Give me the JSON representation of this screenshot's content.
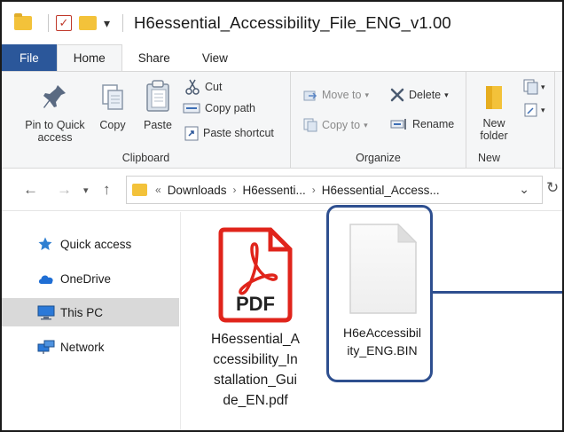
{
  "window": {
    "title": "H6essential_Accessibility_File_ENG_v1.00"
  },
  "tabs": [
    {
      "label": "File"
    },
    {
      "label": "Home"
    },
    {
      "label": "Share"
    },
    {
      "label": "View"
    }
  ],
  "ribbon": {
    "clipboard": {
      "label": "Clipboard",
      "pin": "Pin to Quick access",
      "pin_line1": "Pin to Quick",
      "pin_line2": "access",
      "copy": "Copy",
      "paste": "Paste",
      "cut": "Cut",
      "copy_path": "Copy path",
      "paste_shortcut": "Paste shortcut"
    },
    "organize": {
      "label": "Organize",
      "move_to": "Move to",
      "copy_to": "Copy to",
      "delete": "Delete",
      "rename": "Rename"
    },
    "new": {
      "label": "New",
      "new_folder_line1": "New",
      "new_folder_line2": "folder"
    }
  },
  "address": {
    "overflow": "«",
    "crumbs": [
      "Downloads",
      "H6essenti...",
      "H6essential_Access..."
    ]
  },
  "sidebar": {
    "items": [
      {
        "label": "Quick access",
        "icon": "star-icon"
      },
      {
        "label": "OneDrive",
        "icon": "cloud-icon"
      },
      {
        "label": "This PC",
        "icon": "computer-icon"
      },
      {
        "label": "Network",
        "icon": "network-icon"
      }
    ]
  },
  "files": [
    {
      "name_lines": [
        "H6essential_A",
        "ccessibility_In",
        "stallation_Gui",
        "de_EN.pdf"
      ],
      "badge": "PDF",
      "icon": "pdf-icon"
    },
    {
      "name_lines": [
        "H6eAccessibil",
        "ity_ENG.BIN"
      ],
      "icon": "blank-file-icon"
    }
  ],
  "colors": {
    "file_tab": "#2b579a",
    "folder": "#f3c23a",
    "highlight": "#2e4f8f",
    "pdf_red": "#e0241b"
  }
}
